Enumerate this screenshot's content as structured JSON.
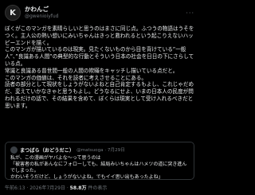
{
  "author": {
    "avatar_glyph": "K",
    "display_name": "かわんご",
    "handle": "@gwenioiyfud"
  },
  "more_glyph": "···",
  "body": [
    "ぼくがこのマンガを素晴らしいと思うのはまさに同じ点。ふつうの物語はうそをつく。主人公の熱い想いにみいちゃんはきっと救われるという起こりえないハッピーエンドを描く。",
    "このマンガが描いているのは現実。見たくないものから目を背けている”一般人”、”良識ある人間”の典型的な行動とそういう日本の社会を日日の下にさらしている点。",
    "常識と良識ある普世間一般の人間の欺瞞をキャッチし描いている点だと。",
    "このマンガの価値は、それを読者に考えさせることにある。",
    "読者の部分として現状をしょうがないよねと自己肯定するもよし、これじゃだめだ、変えていかなきゃと思うもよし。どうなるにせよ、いまの日本人の民度が問われるだけの話で、その結果を含めて、ぼくらは現実として受け入れるべきだと思います。"
  ],
  "quote": {
    "display_name": "まつばら（おどうだこ）",
    "handle": "@matsuoga · 7月29日",
    "lines": [
      "私が、この漫画がヤバよな～って思うのは",
      "「被害者の私があんなにフォローしても、結局みいちゃんはハメツの道に突き進んでしまった。",
      "かわいそうだけど、しょうがないよね。でもイイ思い出もあったよね」"
    ]
  },
  "footer": {
    "time": "午前6:13 · 2026年7月29日 · ",
    "views": "58.8万",
    "views_suffix": " 件の表示"
  }
}
